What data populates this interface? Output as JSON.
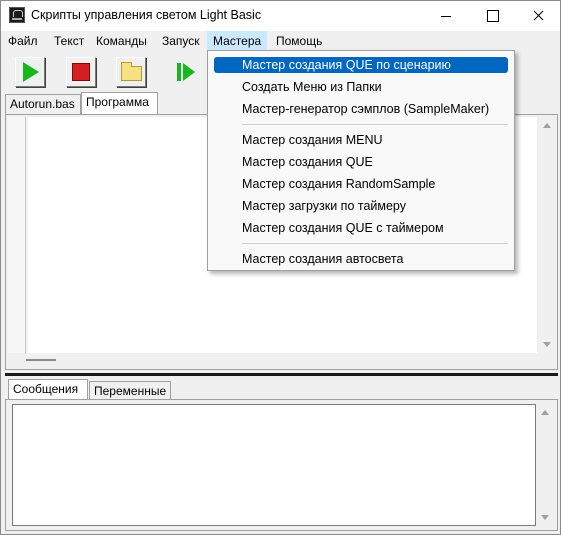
{
  "window": {
    "title": "Скрипты управления светом Light Basic"
  },
  "menubar": {
    "items": [
      "Файл",
      "Текст",
      "Команды",
      "Запуск",
      "Мастера",
      "Помощь"
    ],
    "open_menu": "Мастера"
  },
  "toolbar": {
    "buttons": [
      "run-icon",
      "stop-icon",
      "open-folder-icon",
      "step-run-icon"
    ]
  },
  "editor_tabs": [
    "Autorun.bas",
    "Программа"
  ],
  "editor_active_tab": "Программа",
  "bottom_tabs": [
    "Сообщения",
    "Переменные"
  ],
  "bottom_active_tab": "Сообщения",
  "dropdown": {
    "items": [
      "Мастер создания QUE по сценарию",
      "Создать Меню из Папки",
      "Мастер-генератор сэмплов (SampleMaker)",
      "Мастер создания MENU",
      "Мастер создания QUE",
      "Мастер создания RandomSample",
      "Мастер загрузки по таймеру",
      "Мастер создания QUE с таймером",
      "Мастер создания автосвета"
    ],
    "highlighted": "Мастер создания QUE по сценарию"
  },
  "colors": {
    "highlight": "#0067c0",
    "menu_hover": "#cce8ff",
    "run_green": "#19b51f",
    "stop_red": "#d42020"
  }
}
